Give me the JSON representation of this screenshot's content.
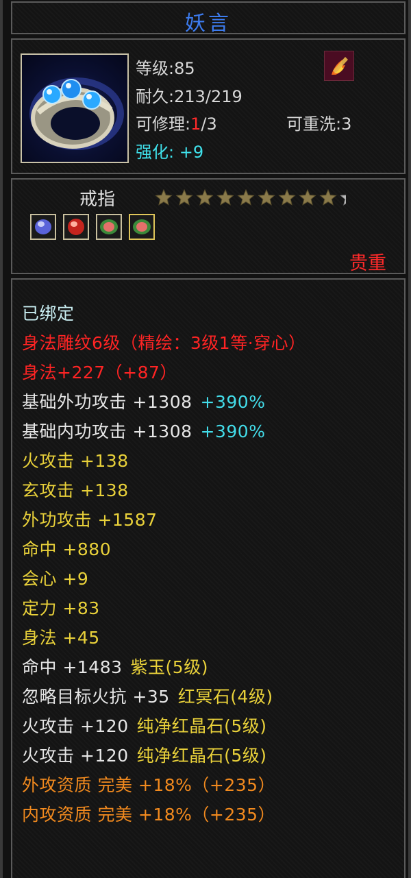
{
  "title": "妖言",
  "header": {
    "level_label": "等级",
    "level_value": "85",
    "durability_label": "耐久",
    "durability_value": "213/219",
    "repair_label": "可修理",
    "repair_current": "1",
    "repair_max": "/3",
    "rewash_label": "可重洗",
    "rewash_value": "3",
    "enhance_label": "强化",
    "enhance_value": "+9",
    "item_icon": "ring-icon",
    "skill_icon": "flame-weapon-icon"
  },
  "middle": {
    "type_label": "戒指",
    "stars_total": 9,
    "stars_filled": 8,
    "gems": [
      "blue-gem-icon",
      "red-gem-icon",
      "green-red-gem-icon",
      "green-red-gem-icon"
    ],
    "rarity": "贵重"
  },
  "stats": [
    {
      "text": "已绑定",
      "color": "light"
    },
    {
      "text": "身法雕纹6级（精绘：3级1等·穿心）",
      "color": "red"
    },
    {
      "text": "身法+227（+87）",
      "color": "red"
    },
    {
      "text": "基础外功攻击 +1308",
      "extra": "+390%",
      "color": "white",
      "extra_color": "cyan"
    },
    {
      "text": "基础内功攻击 +1308",
      "extra": "+390%",
      "color": "white",
      "extra_color": "cyan"
    },
    {
      "text": "火攻击 +138",
      "color": "yellow"
    },
    {
      "text": "玄攻击 +138",
      "color": "yellow"
    },
    {
      "text": "外功攻击 +1587",
      "color": "yellow"
    },
    {
      "text": "命中 +880",
      "color": "yellow"
    },
    {
      "text": "会心 +9",
      "color": "yellow"
    },
    {
      "text": "定力 +83",
      "color": "yellow"
    },
    {
      "text": "身法 +45",
      "color": "yellow"
    },
    {
      "text": "命中 +1483",
      "extra": "紫玉(5级)",
      "color": "white",
      "extra_color": "yellow"
    },
    {
      "text": "忽略目标火抗 +35",
      "extra": "红冥石(4级)",
      "color": "white",
      "extra_color": "yellow"
    },
    {
      "text": "火攻击 +120",
      "extra": "纯净红晶石(5级)",
      "color": "white",
      "extra_color": "yellow"
    },
    {
      "text": "火攻击 +120",
      "extra": "纯净红晶石(5级)",
      "color": "white",
      "extra_color": "yellow"
    },
    {
      "text": "外攻资质  完美 +18%（+235）",
      "color": "orange"
    },
    {
      "text": "内攻资质  完美 +18%（+235）",
      "color": "orange"
    }
  ],
  "colors": {
    "title": "#3d7cf0",
    "red": "#ff2424",
    "cyan": "#43ddea",
    "yellow": "#e9d13a",
    "orange": "#f28a1e",
    "border": "#5a5a5a"
  }
}
